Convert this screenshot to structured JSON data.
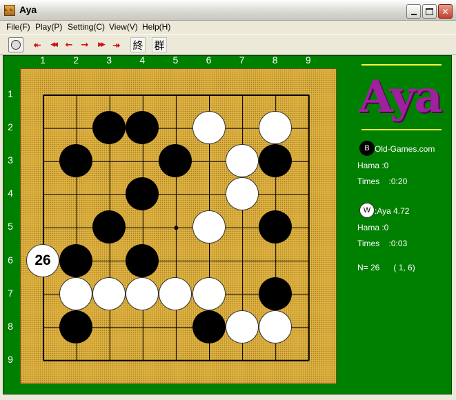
{
  "window": {
    "title": "Aya"
  },
  "menu": [
    "File(F)",
    "Play(P)",
    "Setting(C)",
    "View(V)",
    "Help(H)"
  ],
  "toolbar": {
    "buttons": [
      {
        "name": "pass-button",
        "glyph": ""
      },
      {
        "name": "first-move-button",
        "glyph": "⯬"
      },
      {
        "name": "back-ten-button",
        "glyph": "◀◀"
      },
      {
        "name": "back-one-button",
        "glyph": "←"
      },
      {
        "name": "forward-one-button",
        "glyph": "→"
      },
      {
        "name": "forward-ten-button",
        "glyph": "▶▶"
      },
      {
        "name": "last-move-button",
        "glyph": "⯮"
      }
    ],
    "end_label": "終",
    "group_label": "群"
  },
  "board": {
    "columns": [
      "1",
      "2",
      "3",
      "4",
      "5",
      "6",
      "7",
      "8",
      "9"
    ],
    "rows": [
      "1",
      "2",
      "3",
      "4",
      "5",
      "6",
      "7",
      "8",
      "9"
    ],
    "stones": [
      {
        "c": 3,
        "r": 2,
        "color": "black"
      },
      {
        "c": 4,
        "r": 2,
        "color": "black"
      },
      {
        "c": 6,
        "r": 2,
        "color": "white"
      },
      {
        "c": 8,
        "r": 2,
        "color": "white"
      },
      {
        "c": 2,
        "r": 3,
        "color": "black"
      },
      {
        "c": 5,
        "r": 3,
        "color": "black"
      },
      {
        "c": 7,
        "r": 3,
        "color": "white"
      },
      {
        "c": 8,
        "r": 3,
        "color": "black"
      },
      {
        "c": 4,
        "r": 4,
        "color": "black"
      },
      {
        "c": 7,
        "r": 4,
        "color": "white"
      },
      {
        "c": 3,
        "r": 5,
        "color": "black"
      },
      {
        "c": 6,
        "r": 5,
        "color": "white"
      },
      {
        "c": 8,
        "r": 5,
        "color": "black"
      },
      {
        "c": 2,
        "r": 6,
        "color": "black"
      },
      {
        "c": 4,
        "r": 6,
        "color": "black"
      },
      {
        "c": 2,
        "r": 7,
        "color": "white"
      },
      {
        "c": 3,
        "r": 7,
        "color": "white"
      },
      {
        "c": 4,
        "r": 7,
        "color": "white"
      },
      {
        "c": 5,
        "r": 7,
        "color": "white"
      },
      {
        "c": 6,
        "r": 7,
        "color": "white"
      },
      {
        "c": 8,
        "r": 7,
        "color": "black"
      },
      {
        "c": 2,
        "r": 8,
        "color": "black"
      },
      {
        "c": 6,
        "r": 8,
        "color": "black"
      },
      {
        "c": 7,
        "r": 8,
        "color": "white"
      },
      {
        "c": 8,
        "r": 8,
        "color": "white"
      }
    ],
    "last_move": {
      "c": 1,
      "r": 6,
      "label": "26"
    }
  },
  "panel": {
    "logo": "Aya",
    "black": {
      "badge": "B",
      "name": "Old-Games.com",
      "hama": "Hama :0",
      "times": "Times    :0:20"
    },
    "white": {
      "badge": "W",
      "name": ":Aya 4.72",
      "hama": "Hama :0",
      "times": "Times    :0:03"
    },
    "status": "N= 26      ( 1, 6)"
  },
  "colors": {
    "background": "#008000",
    "board": "#e0b340",
    "logo": "#a020a0"
  }
}
